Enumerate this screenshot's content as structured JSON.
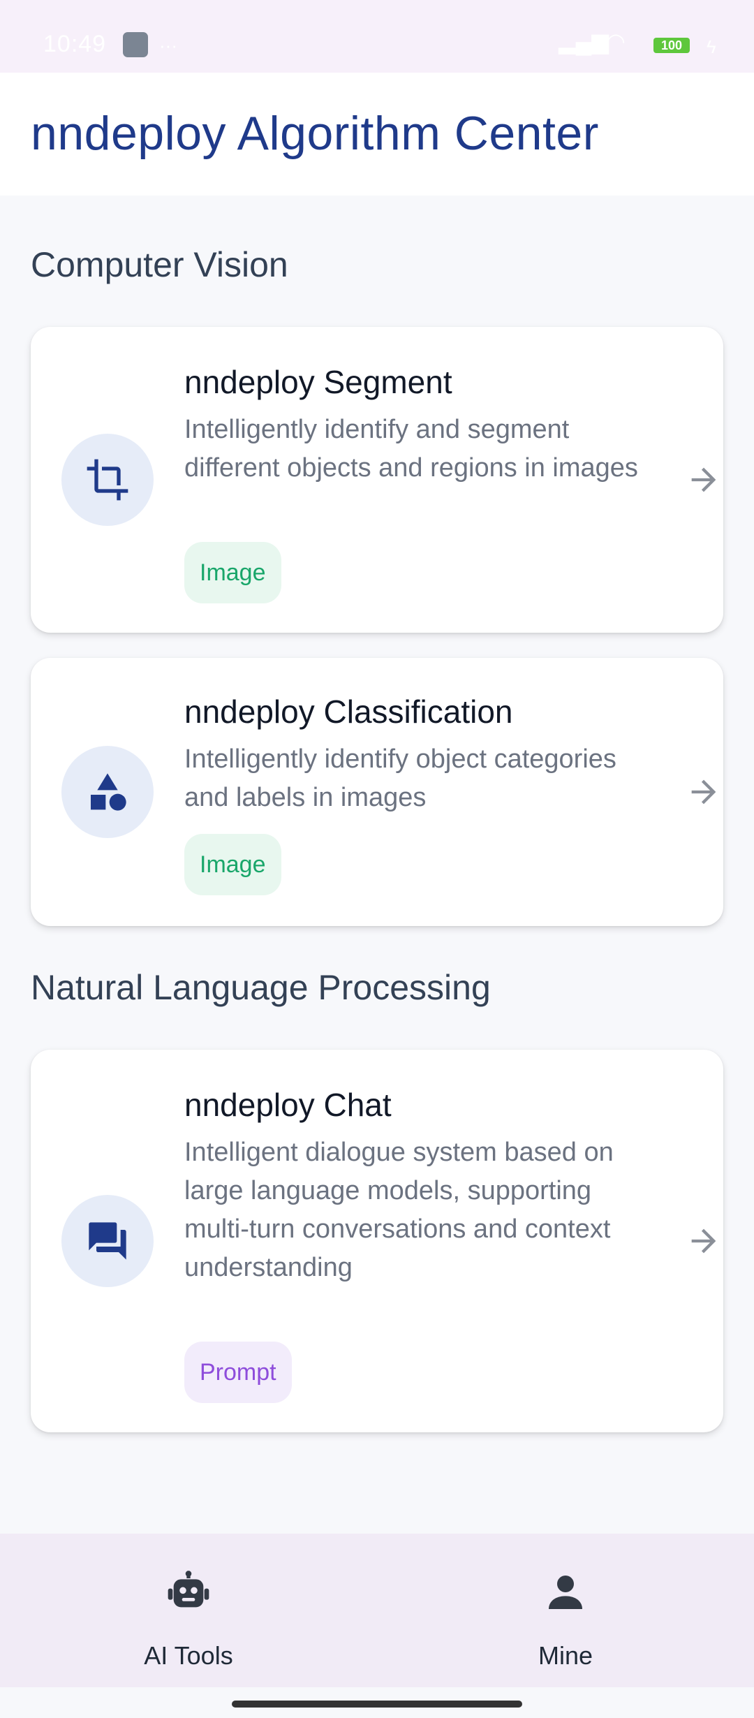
{
  "status_bar": {
    "time": "10:49",
    "battery": "100"
  },
  "app_bar": {
    "title": "nndeploy Algorithm Center"
  },
  "sections": [
    {
      "title": "Computer Vision",
      "cards": [
        {
          "title": "nndeploy Segment",
          "description": "Intelligently identify and segment different objects and regions in images",
          "tag": "Image",
          "icon": "crop-icon"
        },
        {
          "title": "nndeploy Classification",
          "description": "Intelligently identify object categories and labels in images",
          "tag": "Image",
          "icon": "category-shapes-icon"
        }
      ]
    },
    {
      "title": "Natural Language Processing",
      "cards": [
        {
          "title": "nndeploy Chat",
          "description": "Intelligent dialogue system based on large language models, supporting multi-turn conversations and context understanding",
          "tag": "Prompt",
          "icon": "chat-bubbles-icon"
        }
      ]
    }
  ],
  "bottom_nav": {
    "items": [
      {
        "label": "AI Tools",
        "icon": "robot-icon"
      },
      {
        "label": "Mine",
        "icon": "person-icon"
      }
    ]
  },
  "colors": {
    "title_blue": "#1f3a8a",
    "icon_blue": "#1f3a8a",
    "icon_bg": "#e6ecf8",
    "image_tag_text": "#19a66a",
    "image_tag_bg": "#e8f7ef",
    "prompt_tag_text": "#8e4ddb",
    "prompt_tag_bg": "#f2ecfb",
    "nav_bg": "#f1ebf6"
  }
}
